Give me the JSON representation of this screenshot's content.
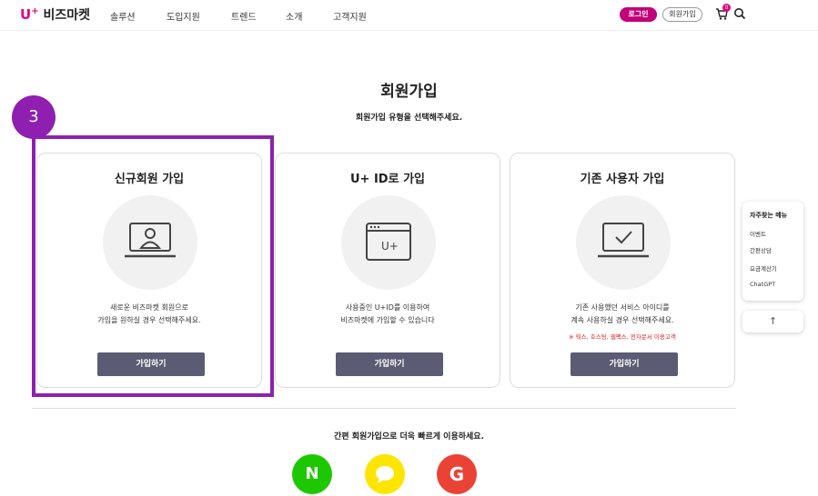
{
  "header": {
    "logo_brand": "U",
    "logo_plus": "+",
    "logo_text": "비즈마켓",
    "nav": [
      "솔루션",
      "도입지원",
      "트렌드",
      "소개",
      "고객지원"
    ],
    "login_label": "로그인",
    "join_label": "회원가입",
    "cart_count": "0",
    "cart_icon": "cart-icon",
    "search_icon": "search-icon"
  },
  "page": {
    "title": "회원가입",
    "subtitle": "회원가입 유형을 선택해주세요."
  },
  "step_badge": "3",
  "cards": [
    {
      "title": "신규회원 가입",
      "icon": "user-laptop-icon",
      "desc_line1": "새로운 비즈마켓 회원으로",
      "desc_line2": "가입을 원하실 경우 선택해주세요.",
      "note": "",
      "button": "가입하기"
    },
    {
      "title": "U+ ID로 가입",
      "icon": "browser-uplus-icon",
      "icon_text": "U+",
      "desc_line1": "사용중인 U+ID를 이용하여",
      "desc_line2": "비즈마켓에 가입할 수 있습니다",
      "note": "",
      "button": "가입하기"
    },
    {
      "title": "기존 사용자 가입",
      "icon": "laptop-check-icon",
      "desc_line1": "기존 사용했던 서비스 아이디를",
      "desc_line2": "계속 사용하실 경우 선택해주세요.",
      "note": "※ 웍스, 호스팅, 웹팩스, 전자문서 이용고객",
      "button": "가입하기"
    }
  ],
  "quick_menu": {
    "title": "자주찾는 메뉴",
    "items": [
      "이벤트",
      "간편상담",
      "요금계산기",
      "ChatGPT"
    ],
    "top_button": "↑"
  },
  "easy_join": {
    "text": "간편 회원가입으로 더욱 빠르게 이용하세요.",
    "naver_label": "N",
    "google_label": "G"
  },
  "colors": {
    "brand": "#e6007e",
    "login_button": "#c2007a",
    "highlight": "#8e1fb0",
    "card_button": "#5b5b73",
    "note": "#e02020",
    "naver": "#1ec800",
    "kakao": "#fee500",
    "google": "#ea4335"
  }
}
